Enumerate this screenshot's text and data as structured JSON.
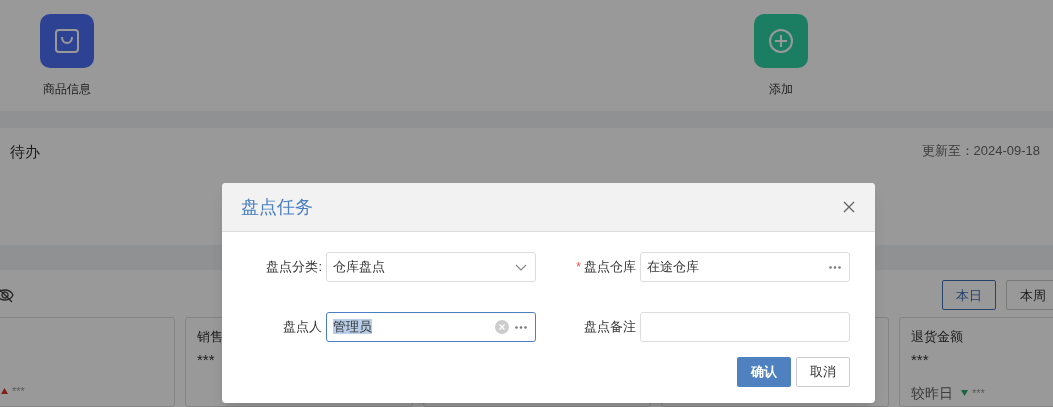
{
  "shortcuts": [
    {
      "label": "商品信息",
      "kind": "bag"
    },
    {
      "label": "添加",
      "kind": "add"
    }
  ],
  "todo": {
    "title": "待办",
    "updated": "更新至：2024-09-18"
  },
  "stats": {
    "periods": [
      {
        "label": "本日",
        "selected": true
      },
      {
        "label": "本周",
        "selected": false
      }
    ],
    "cards": [
      {
        "rising": true,
        "delta": "***"
      },
      {
        "label": "销售",
        "value": "***"
      },
      {
        "label": "退货金额",
        "value": "***",
        "compare": "较昨日",
        "rising": false,
        "delta": "***"
      }
    ]
  },
  "dialog": {
    "title": "盘点任务",
    "fields": [
      {
        "label": "盘点分类:",
        "value": "仓库盘点",
        "kind": "select",
        "focused": false
      },
      {
        "marker": "*",
        "label": "盘点仓库",
        "value": "在途仓库",
        "kind": "lookup",
        "focused": false
      },
      {
        "label": "盘点人",
        "value": "管理员",
        "kind": "lookup-clear",
        "focused": true
      },
      {
        "label": "盘点备注",
        "kind": "text",
        "focused": false
      }
    ],
    "buttons": [
      {
        "label": "确认",
        "primary": true
      },
      {
        "label": "取消",
        "primary": false
      }
    ]
  }
}
